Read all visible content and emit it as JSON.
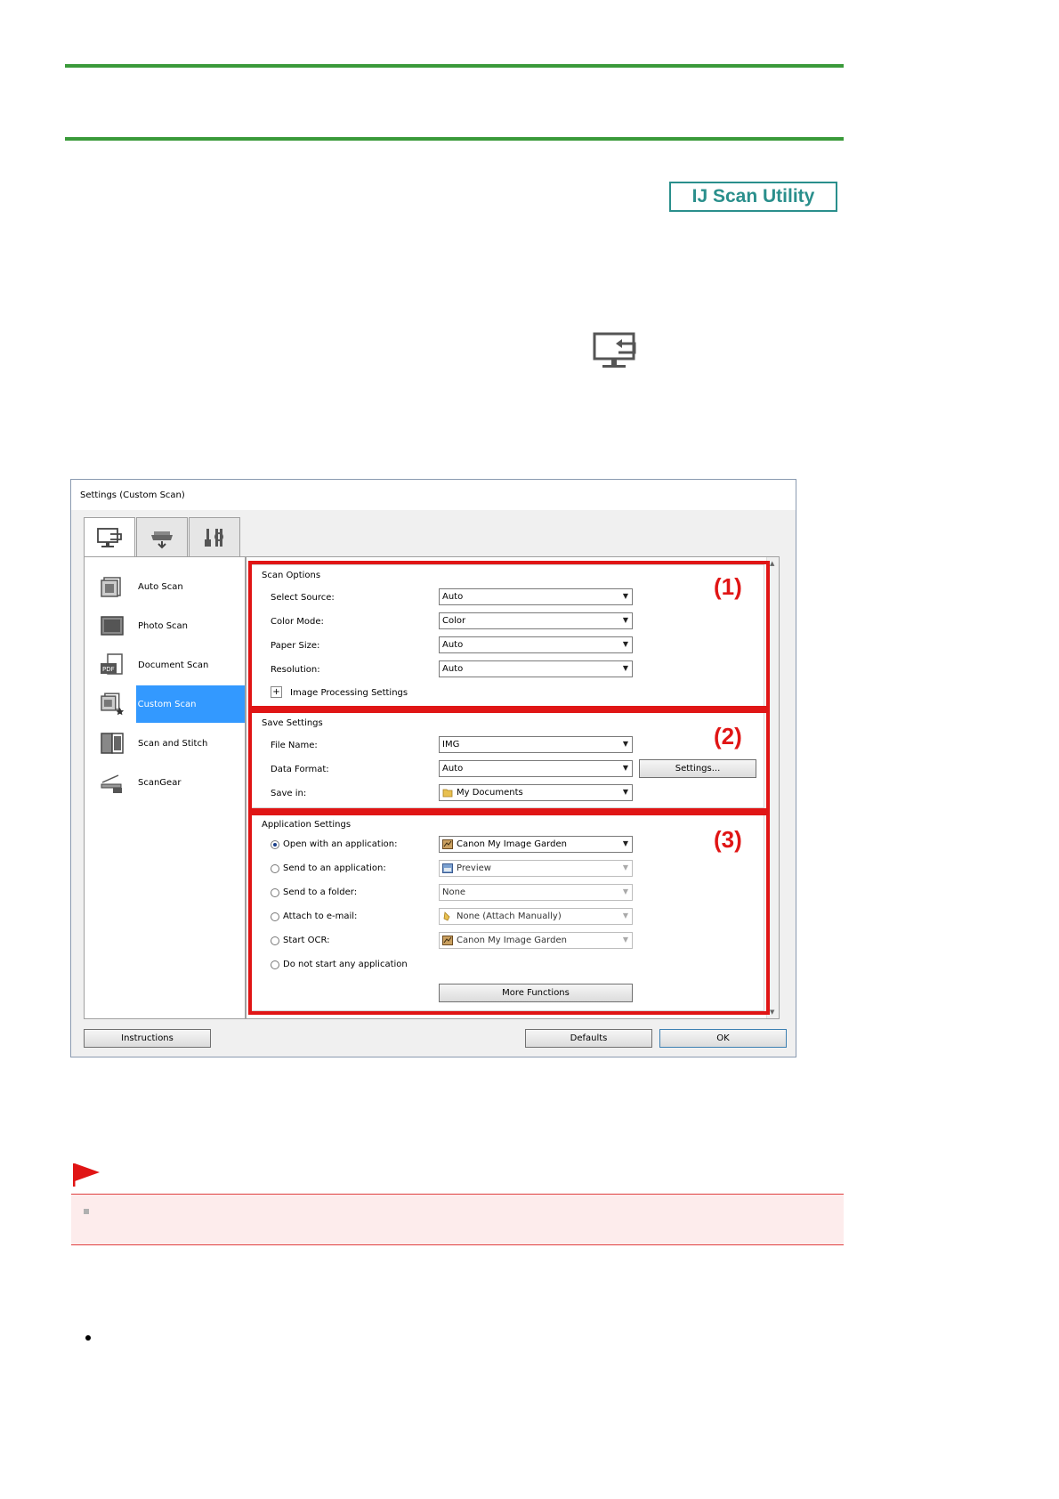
{
  "badge": {
    "label": "IJ Scan Utility"
  },
  "dialog": {
    "title": "Settings (Custom Scan)",
    "tabs": [
      {
        "icon": "scan-from-computer-icon"
      },
      {
        "icon": "scan-from-operation-panel-icon"
      },
      {
        "icon": "general-settings-icon"
      }
    ],
    "nav": [
      {
        "label": "Auto Scan",
        "icon": "auto-scan-icon"
      },
      {
        "label": "Photo Scan",
        "icon": "photo-scan-icon"
      },
      {
        "label": "Document Scan",
        "icon": "document-scan-icon"
      },
      {
        "label": "Custom Scan",
        "icon": "custom-scan-icon",
        "selected": true
      },
      {
        "label": "Scan and Stitch",
        "icon": "scan-and-stitch-icon"
      },
      {
        "label": "ScanGear",
        "icon": "scangear-icon"
      }
    ],
    "scan_options": {
      "title": "Scan Options",
      "callout": "(1)",
      "rows": [
        {
          "label": "Select Source:",
          "value": "Auto"
        },
        {
          "label": "Color Mode:",
          "value": "Color"
        },
        {
          "label": "Paper Size:",
          "value": "Auto"
        },
        {
          "label": "Resolution:",
          "value": "Auto"
        }
      ],
      "image_processing": "Image Processing Settings"
    },
    "save_settings": {
      "title": "Save Settings",
      "callout": "(2)",
      "file_name_label": "File Name:",
      "file_name_value": "IMG",
      "data_format_label": "Data Format:",
      "data_format_value": "Auto",
      "settings_button": "Settings...",
      "save_in_label": "Save in:",
      "save_in_value": "My Documents"
    },
    "application_settings": {
      "title": "Application Settings",
      "callout": "(3)",
      "options": [
        {
          "label": "Open with an application:",
          "value": "Canon My Image Garden",
          "selected": true,
          "enabled": true
        },
        {
          "label": "Send to an application:",
          "value": "Preview",
          "selected": false,
          "enabled": false
        },
        {
          "label": "Send to a folder:",
          "value": "None",
          "selected": false,
          "enabled": false
        },
        {
          "label": "Attach to e-mail:",
          "value": "None (Attach Manually)",
          "selected": false,
          "enabled": false
        },
        {
          "label": "Start OCR:",
          "value": "Canon My Image Garden",
          "selected": false,
          "enabled": false
        },
        {
          "label": "Do not start any application",
          "value": "",
          "selected": false,
          "enabled": false
        }
      ],
      "more_functions": "More Functions"
    },
    "buttons": {
      "instructions": "Instructions",
      "defaults": "Defaults",
      "ok": "OK"
    }
  },
  "colors": {
    "rule": "#3a9a3a",
    "badge": "#2a8f8c",
    "callout": "#e01515",
    "selection": "#3399ff"
  }
}
